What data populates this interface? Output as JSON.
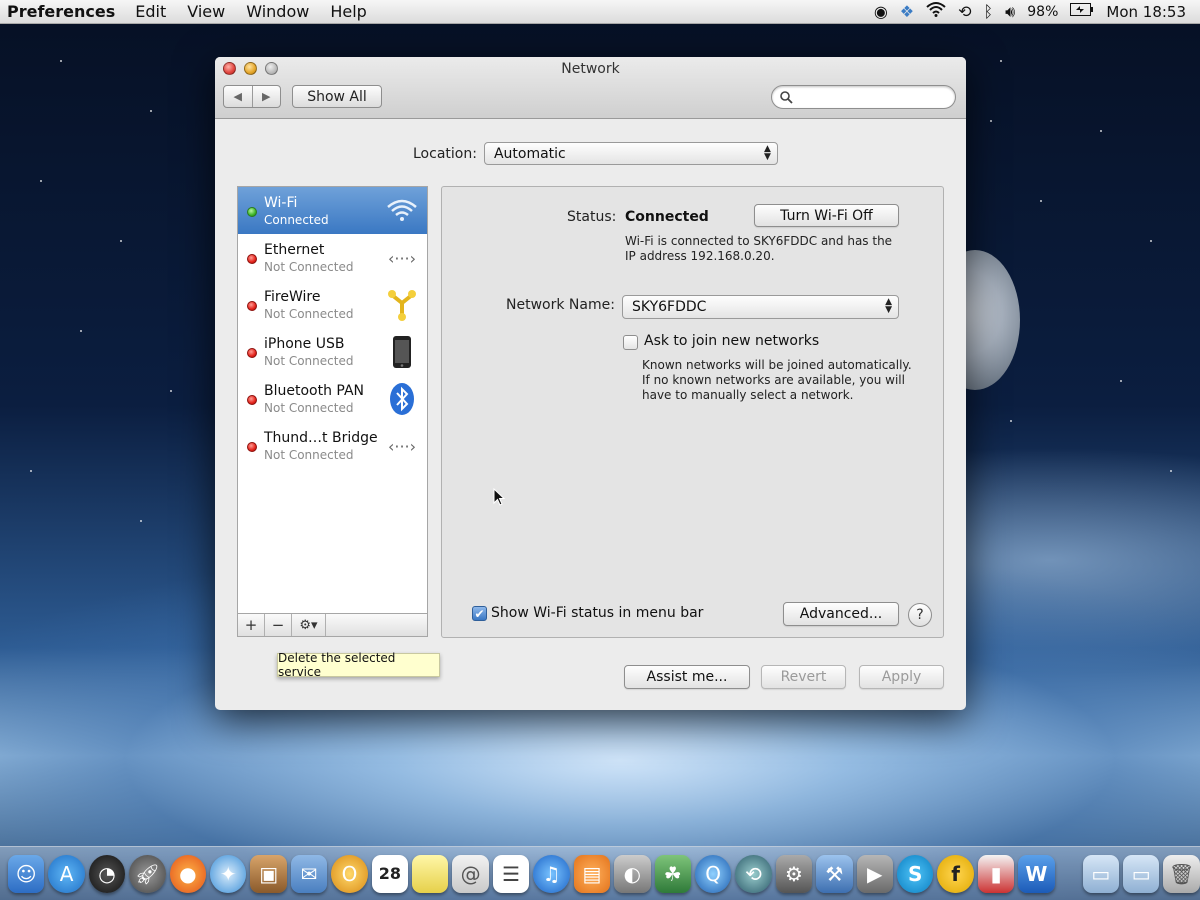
{
  "menubar": {
    "app_name": "Preferences",
    "menus": [
      "Edit",
      "View",
      "Window",
      "Help"
    ],
    "battery": "98%",
    "clock": "Mon 18:53",
    "status_icons": [
      "recording-icon",
      "dropbox-icon",
      "wifi-icon",
      "time-machine-icon",
      "bluetooth-icon",
      "volume-icon",
      "battery-icon"
    ]
  },
  "window": {
    "title": "Network",
    "show_all_label": "Show All",
    "search_placeholder": "",
    "location_label": "Location:",
    "location_value": "Automatic"
  },
  "services": [
    {
      "name": "Wi-Fi",
      "status": "Connected",
      "state": "green",
      "icon": "wifi-icon",
      "selected": true
    },
    {
      "name": "Ethernet",
      "status": "Not Connected",
      "state": "red",
      "icon": "ethernet-icon",
      "selected": false
    },
    {
      "name": "FireWire",
      "status": "Not Connected",
      "state": "red",
      "icon": "firewire-icon",
      "selected": false
    },
    {
      "name": "iPhone USB",
      "status": "Not Connected",
      "state": "red",
      "icon": "iphone-icon",
      "selected": false
    },
    {
      "name": "Bluetooth PAN",
      "status": "Not Connected",
      "state": "red",
      "icon": "bluetooth-icon",
      "selected": false
    },
    {
      "name": "Thund…t Bridge",
      "status": "Not Connected",
      "state": "red",
      "icon": "thunderbolt-bridge-icon",
      "selected": false
    }
  ],
  "sidebar_footer": {
    "add": "+",
    "remove": "−",
    "action": "⚙▾"
  },
  "tooltip": "Delete the selected service",
  "detail": {
    "status_label": "Status:",
    "status_value": "Connected",
    "turn_off_label": "Turn Wi-Fi Off",
    "status_desc_1": "Wi-Fi is connected to SKY6FDDC and has the",
    "status_desc_2": "IP address 192.168.0.20.",
    "network_name_label": "Network Name:",
    "network_name_value": "SKY6FDDC",
    "ask_join_label": "Ask to join new networks",
    "ask_join_checked": false,
    "ask_desc_1": "Known networks will be joined automatically.",
    "ask_desc_2": "If no known networks are available, you will",
    "ask_desc_3": "have to manually select a network.",
    "show_status_label": "Show Wi-Fi status in menu bar",
    "show_status_checked": true,
    "advanced_label": "Advanced...",
    "help_label": "?"
  },
  "footer": {
    "assist_label": "Assist me...",
    "revert_label": "Revert",
    "apply_label": "Apply"
  },
  "dock": {
    "icons": [
      "finder-icon",
      "app-store-icon",
      "dashboard-icon",
      "launchpad-icon",
      "firefox-icon",
      "safari-icon",
      "preview-icon",
      "mail-icon",
      "notes-icon",
      "calendar-icon",
      "stickies-icon",
      "contacts-icon",
      "reminders-icon",
      "itunes-icon",
      "ibooks-icon",
      "photo-booth-icon",
      "iphoto-icon",
      "quicktime-icon",
      "time-machine-icon",
      "system-preferences-icon",
      "xcode-icon",
      "facetime-icon",
      "skype-icon",
      "fontlab-icon",
      "flashcard-icon",
      "word-icon",
      "applications-folder-icon",
      "documents-folder-icon",
      "trash-icon"
    ],
    "calendar_day": "28"
  }
}
